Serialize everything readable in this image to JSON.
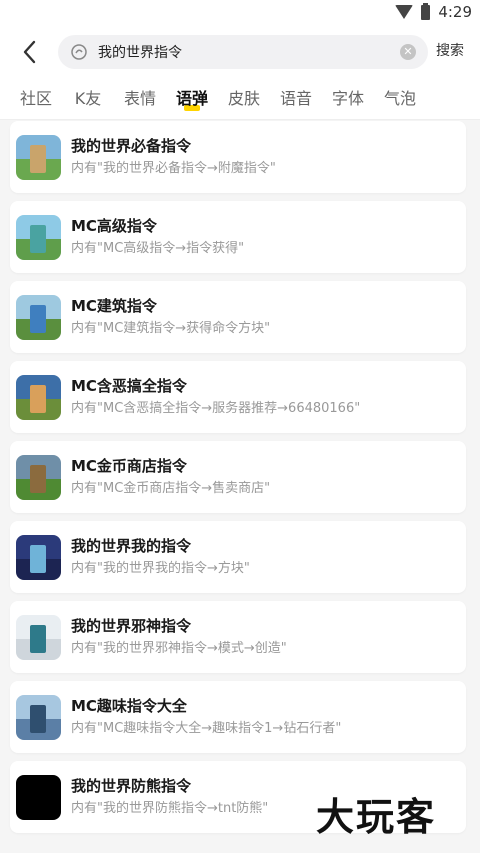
{
  "status": {
    "time": "4:29"
  },
  "header": {
    "search_value": "我的世界指令",
    "search_button": "搜索"
  },
  "tabs": [
    {
      "label": "社区"
    },
    {
      "label": "K友"
    },
    {
      "label": "表情"
    },
    {
      "label": "语弹",
      "active": true
    },
    {
      "label": "皮肤"
    },
    {
      "label": "语音"
    },
    {
      "label": "字体"
    },
    {
      "label": "气泡"
    }
  ],
  "results": [
    {
      "title": "我的世界必备指令",
      "desc": "内有\"我的世界必备指令→附魔指令\"",
      "thumb": {
        "sky": "#7fb5d9",
        "ground": "#6aa84f",
        "figure": "#c9a46b"
      }
    },
    {
      "title": "MC高级指令",
      "desc": "内有\"MC高级指令→指令获得\"",
      "thumb": {
        "sky": "#8ecae6",
        "ground": "#5f9e4b",
        "figure": "#4aa3a1"
      }
    },
    {
      "title": "MC建筑指令",
      "desc": "内有\"MC建筑指令→获得命令方块\"",
      "thumb": {
        "sky": "#9ec9e0",
        "ground": "#5a8f3e",
        "figure": "#3f7fbf"
      }
    },
    {
      "title": "MC含恶搞全指令",
      "desc": "内有\"MC含恶搞全指令→服务器推荐→66480166\"",
      "thumb": {
        "sky": "#3d6fa8",
        "ground": "#6b8e3a",
        "figure": "#d9a05b"
      }
    },
    {
      "title": "MC金币商店指令",
      "desc": "内有\"MC金币商店指令→售卖商店\"",
      "thumb": {
        "sky": "#6f8fa8",
        "ground": "#4f8a33",
        "figure": "#8b6b3e"
      }
    },
    {
      "title": "我的世界我的指令",
      "desc": "内有\"我的世界我的指令→方块\"",
      "thumb": {
        "sky": "#2b3a7a",
        "ground": "#1c2452",
        "figure": "#6fb3d8"
      }
    },
    {
      "title": "我的世界邪神指令",
      "desc": "内有\"我的世界邪神指令→模式→创造\"",
      "thumb": {
        "sky": "#e9eef2",
        "ground": "#cfd6dc",
        "figure": "#2e7a8a"
      }
    },
    {
      "title": "MC趣味指令大全",
      "desc": "内有\"MC趣味指令大全→趣味指令1→钻石行者\"",
      "thumb": {
        "sky": "#a7c7e0",
        "ground": "#5b7fa6",
        "figure": "#2f4f6f"
      }
    },
    {
      "title": "我的世界防熊指令",
      "desc": "内有\"我的世界防熊指令→tnt防熊\"",
      "thumb": {
        "sky": "#000000",
        "ground": "#000000",
        "figure": "#000000"
      }
    }
  ],
  "watermark": "大玩客"
}
